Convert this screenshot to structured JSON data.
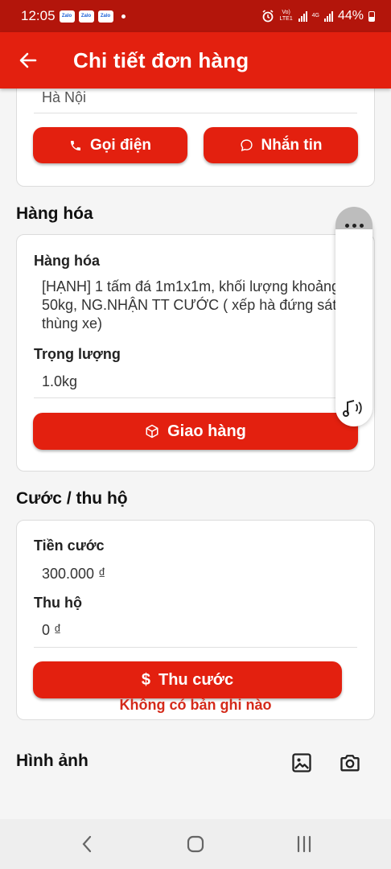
{
  "status_bar": {
    "time": "12:05",
    "notification_apps": [
      "Zalo",
      "Zalo",
      "Zalo"
    ],
    "network_label": "Vo) LTE1",
    "network_type": "4G",
    "battery": "44%"
  },
  "header": {
    "title": "Chi tiết đơn hàng",
    "background_color": "#e3200f"
  },
  "contact": {
    "address_partial": "Hà Nội",
    "call_label": "Gọi điện",
    "message_label": "Nhắn tin"
  },
  "goods": {
    "section_title": "Hàng hóa",
    "goods_label": "Hàng hóa",
    "goods_value": "[HẠNH] 1 tấm đá 1m1x1m, khối lượng khoảng 50kg, NG.NHẬN TT CƯỚC ( xếp hà đứng sát thùng xe)",
    "weight_label": "Trọng lượng",
    "weight_value": "1.0kg",
    "deliver_label": "Giao hàng"
  },
  "fees": {
    "section_title": "Cước / thu hộ",
    "shipping_fee_label": "Tiền cước",
    "shipping_fee_value": "300.000 ₫",
    "cod_label": "Thu hộ",
    "cod_value": "0 ₫",
    "collect_label": "Thu cước"
  },
  "images": {
    "section_title": "Hình ảnh",
    "empty_message": "Không có bản ghi nào"
  },
  "floating_panel": {
    "icons": [
      "more-icon",
      "audio-icon"
    ]
  }
}
